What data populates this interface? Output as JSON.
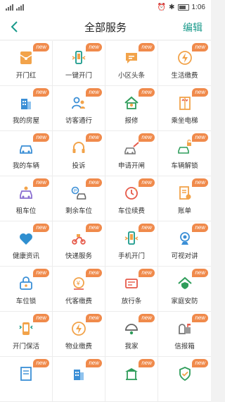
{
  "status_bar": {
    "time": "1:06"
  },
  "header": {
    "title": "全部服务",
    "edit_label": "编辑",
    "back_glyph": "‹"
  },
  "badge_text": "new",
  "colors": {
    "accent": "#1a9a8b",
    "badge": "#f08a4b",
    "icon_orange": "#f2a34a",
    "icon_red": "#e65a4a",
    "icon_blue": "#3b8fd6"
  },
  "services": [
    {
      "label": "开门红",
      "icon": "red-envelope-icon"
    },
    {
      "label": "一键开门",
      "icon": "phone-door-icon"
    },
    {
      "label": "小区头条",
      "icon": "chat-bubble-icon"
    },
    {
      "label": "生活缴费",
      "icon": "lightning-icon"
    },
    {
      "label": "我的房屋",
      "icon": "building-icon"
    },
    {
      "label": "访客通行",
      "icon": "visitor-icon"
    },
    {
      "label": "报修",
      "icon": "repair-house-icon"
    },
    {
      "label": "乘坐电梯",
      "icon": "elevator-icon"
    },
    {
      "label": "我的车辆",
      "icon": "car-icon"
    },
    {
      "label": "投诉",
      "icon": "headset-icon"
    },
    {
      "label": "申请开闸",
      "icon": "gate-car-icon"
    },
    {
      "label": "车辆解锁",
      "icon": "car-unlock-icon"
    },
    {
      "label": "租车位",
      "icon": "car-rent-icon"
    },
    {
      "label": "剩余车位",
      "icon": "parking-icon"
    },
    {
      "label": "车位续费",
      "icon": "renew-icon"
    },
    {
      "label": "账单",
      "icon": "bill-icon"
    },
    {
      "label": "健康资讯",
      "icon": "heart-icon"
    },
    {
      "label": "快递服务",
      "icon": "scooter-icon"
    },
    {
      "label": "手机开门",
      "icon": "phone-door-icon"
    },
    {
      "label": "可视对讲",
      "icon": "camera-icon"
    },
    {
      "label": "车位锁",
      "icon": "parking-lock-icon"
    },
    {
      "label": "代客缴费",
      "icon": "coin-icon"
    },
    {
      "label": "放行条",
      "icon": "pass-slip-icon"
    },
    {
      "label": "家庭安防",
      "icon": "home-shield-icon"
    },
    {
      "label": "开门保活",
      "icon": "phone-keepalive-icon"
    },
    {
      "label": "物业缴费",
      "icon": "lightning-icon"
    },
    {
      "label": "我家",
      "icon": "dome-home-icon"
    },
    {
      "label": "信报箱",
      "icon": "mailbox-icon"
    },
    {
      "label": "",
      "icon": "document-icon"
    },
    {
      "label": "",
      "icon": "building-icon"
    },
    {
      "label": "",
      "icon": "pavilion-icon"
    },
    {
      "label": "",
      "icon": "shield-check-icon"
    }
  ]
}
